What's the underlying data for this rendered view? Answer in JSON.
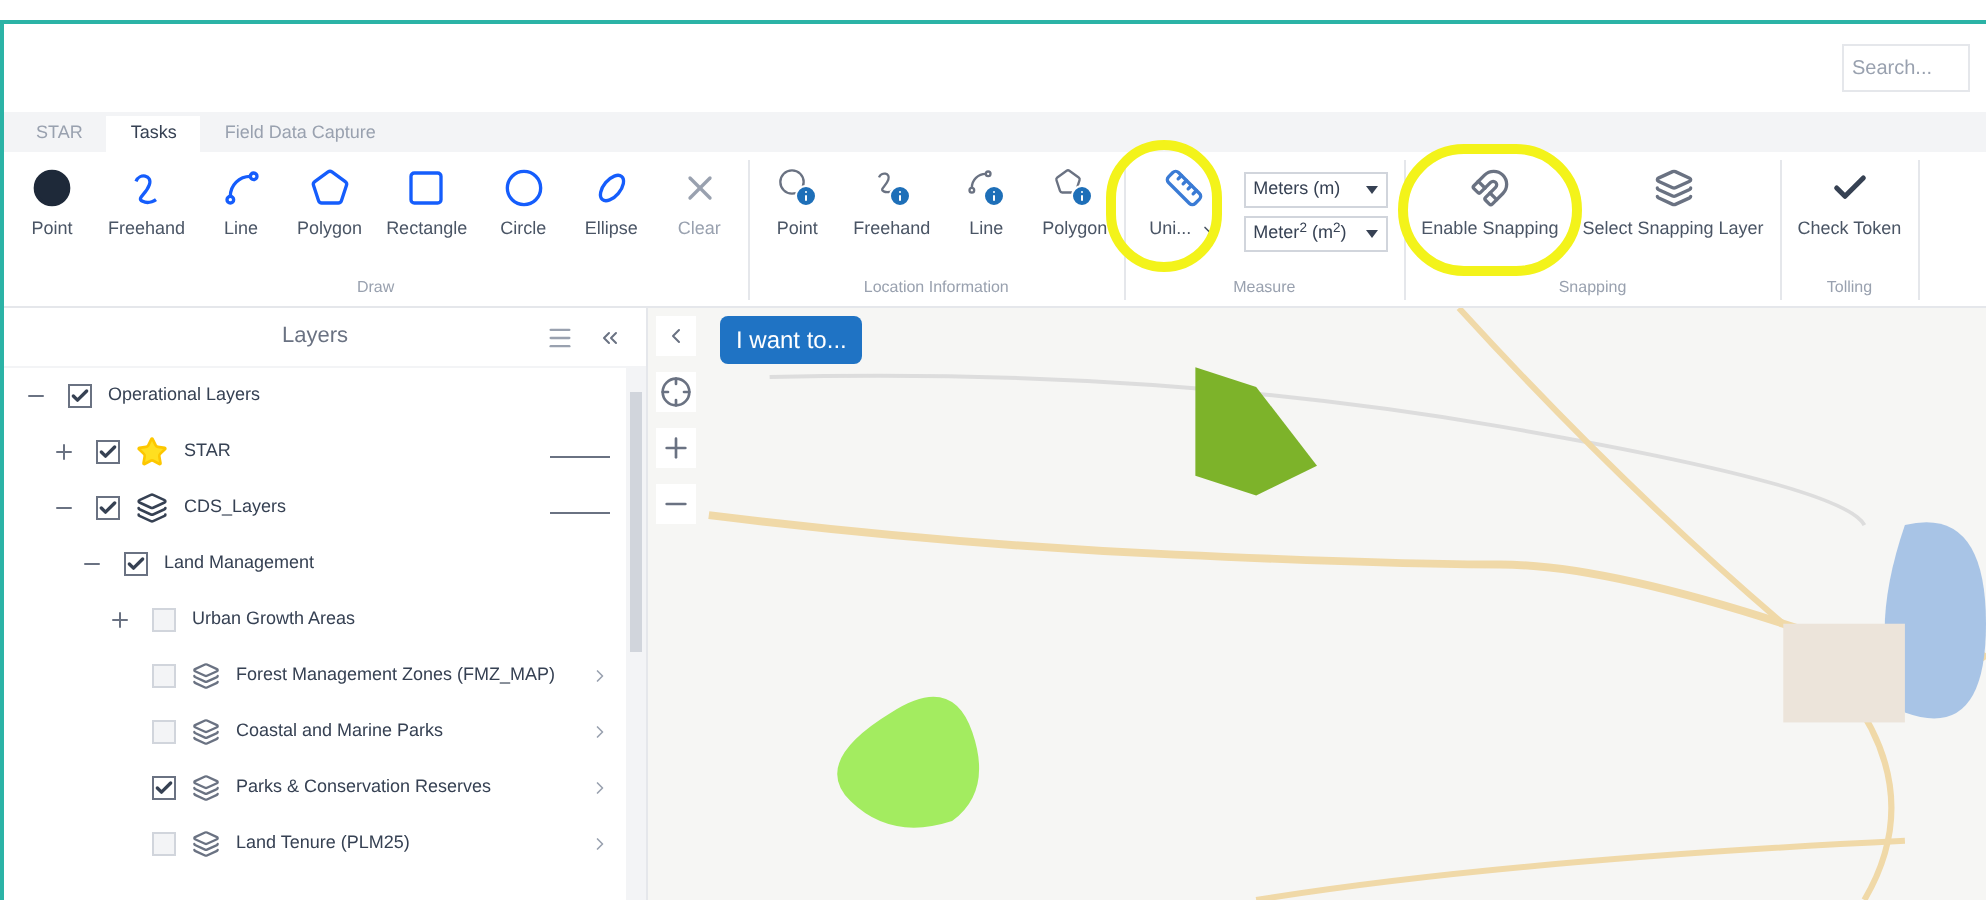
{
  "search": {
    "placeholder": "Search..."
  },
  "tabs": [
    {
      "label": "STAR",
      "selected": false
    },
    {
      "label": "Tasks",
      "selected": true
    },
    {
      "label": "Field Data Capture",
      "selected": false
    }
  ],
  "ribbon": [
    {
      "kind": "tools",
      "label": "Draw",
      "items": [
        {
          "label": "Point",
          "disabled": false
        },
        {
          "label": "Freehand",
          "disabled": false
        },
        {
          "label": "Line",
          "disabled": false
        },
        {
          "label": "Polygon",
          "disabled": false
        },
        {
          "label": "Rectangle",
          "disabled": false
        },
        {
          "label": "Circle",
          "disabled": false
        },
        {
          "label": "Ellipse",
          "disabled": false
        },
        {
          "label": "Clear",
          "disabled": true
        }
      ]
    },
    {
      "kind": "info",
      "label": "Location Information",
      "items": [
        {
          "label": "Point",
          "disabled": false
        },
        {
          "label": "Freehand",
          "disabled": false
        },
        {
          "label": "Line",
          "disabled": false
        },
        {
          "label": "Polygon",
          "disabled": false
        }
      ]
    },
    {
      "kind": "measure",
      "label": "Measure",
      "button": "Uni...",
      "length_unit": "Meters (m)",
      "area_unit": "Meter$^{2}$ (m$^{2}$)"
    },
    {
      "kind": "snapping",
      "label": "Snapping",
      "items": [
        {
          "label": "Enable Snapping",
          "disabled": false
        },
        {
          "label": "Select Snapping Layer",
          "disabled": false
        }
      ]
    },
    {
      "kind": "token",
      "label": "Tolling",
      "items": [
        {
          "label": "Check Token",
          "disabled": false
        }
      ]
    }
  ],
  "layers_panel": {
    "title": "Layers",
    "tree": [
      {
        "label": "Operational Layers",
        "checked": true,
        "expanded": true,
        "children": [
          {
            "label": "STAR",
            "checked": true,
            "expanded": false,
            "level": 1
          },
          {
            "label": "CDS_Layers",
            "checked": true,
            "expanded": true,
            "level": 1,
            "children": [
              {
                "label": "Land Management",
                "checked": true,
                "expanded": true,
                "children": [
                  {
                    "label": "Urban Growth Areas",
                    "checked": false,
                    "expanded": false
                  },
                  {
                    "label": "Forest Management Zones (FMZ_MAP)",
                    "checked": false
                  },
                  {
                    "label": "Coastal and Marine Parks",
                    "checked": false
                  },
                  {
                    "label": "Parks & Conservation Reserves",
                    "checked": true
                  },
                  {
                    "label": "Land Tenure (PLM25)",
                    "checked": false
                  }
                ]
              }
            ]
          }
        ]
      }
    ]
  },
  "map": {
    "menu_button": "I want to..."
  }
}
